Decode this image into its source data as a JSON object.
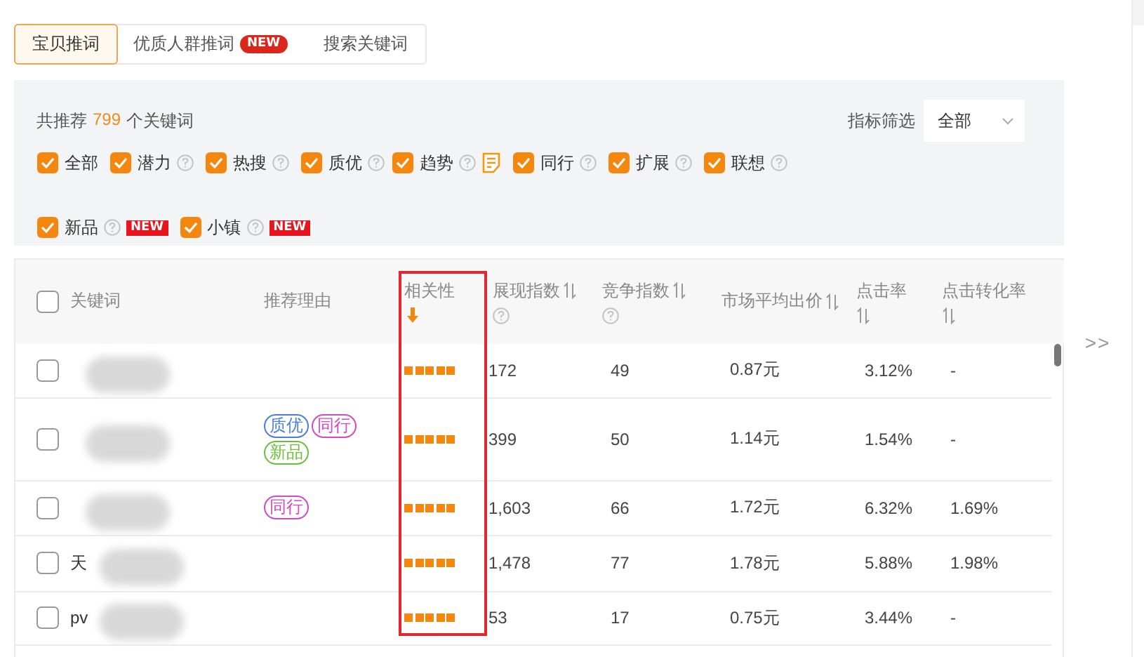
{
  "tabs": [
    {
      "label": "宝贝推词",
      "selected": true
    },
    {
      "label": "优质人群推词",
      "selected": false,
      "badge": "NEW"
    },
    {
      "label": "搜索关键词",
      "selected": false
    }
  ],
  "filters": {
    "summary_prefix": "共推荐",
    "count": "799",
    "summary_suffix": "个关键词",
    "metric_label": "指标筛选",
    "metric_value": "全部",
    "options": [
      {
        "label": "全部",
        "checked": true,
        "help": false
      },
      {
        "label": "潜力",
        "checked": true,
        "help": true
      },
      {
        "label": "热搜",
        "checked": true,
        "help": true
      },
      {
        "label": "质优",
        "checked": true,
        "help": true
      },
      {
        "label": "趋势",
        "checked": true,
        "help": true,
        "note": true
      },
      {
        "label": "同行",
        "checked": true,
        "help": true
      },
      {
        "label": "扩展",
        "checked": true,
        "help": true
      },
      {
        "label": "联想",
        "checked": true,
        "help": true
      },
      {
        "label": "新品",
        "checked": true,
        "help": true,
        "badge": "NEW",
        "line_break_before": true
      },
      {
        "label": "小镇",
        "checked": true,
        "help": true,
        "badge": "NEW"
      }
    ]
  },
  "table": {
    "select_all": false,
    "columns": [
      {
        "label": "关键词",
        "sortable": false,
        "help": false
      },
      {
        "label": "推荐理由",
        "sortable": false,
        "help": false
      },
      {
        "label": "相关性",
        "sortable": false,
        "help": false,
        "sorted_desc": true,
        "highlighted": true
      },
      {
        "label": "展现指数",
        "sortable": true,
        "help": true
      },
      {
        "label": "竞争指数",
        "sortable": true,
        "help": true
      },
      {
        "label": "市场平均出价",
        "sortable": true,
        "help": false
      },
      {
        "label": "点击率",
        "sortable": true,
        "help": false
      },
      {
        "label": "点击转化率",
        "sortable": true,
        "help": false
      }
    ],
    "rows": [
      {
        "cells": [
          {
            "kind": "keyword",
            "checked": false,
            "blurred": true
          },
          {
            "kind": "tags"
          },
          {
            "kind": "rating",
            "stars": 5
          },
          {
            "kind": "text",
            "text": "172"
          },
          {
            "kind": "text",
            "text": "49"
          },
          {
            "kind": "text",
            "text": "0.87元"
          },
          {
            "kind": "text",
            "text": "3.12%"
          },
          {
            "kind": "text",
            "text": "-"
          }
        ]
      },
      {
        "cells": [
          {
            "kind": "keyword",
            "checked": false,
            "blurred": true
          },
          {
            "kind": "tags",
            "tags": [
              {
                "label": "质优",
                "color": "#4a7fe0"
              },
              {
                "label": "同行",
                "color": "#d24bc3"
              },
              {
                "label": "新品",
                "color": "#6cbf3a"
              }
            ]
          },
          {
            "kind": "rating",
            "stars": 5
          },
          {
            "kind": "text",
            "text": "399"
          },
          {
            "kind": "text",
            "text": "50"
          },
          {
            "kind": "text",
            "text": "1.14元"
          },
          {
            "kind": "text",
            "text": "1.54%"
          },
          {
            "kind": "text",
            "text": "-"
          }
        ]
      },
      {
        "cells": [
          {
            "kind": "keyword",
            "checked": false,
            "blurred": true
          },
          {
            "kind": "tags",
            "tags": [
              {
                "label": "同行",
                "color": "#d24bc3"
              }
            ]
          },
          {
            "kind": "rating",
            "stars": 5
          },
          {
            "kind": "text",
            "text": "1,603"
          },
          {
            "kind": "text",
            "text": "66"
          },
          {
            "kind": "text",
            "text": "1.72元"
          },
          {
            "kind": "text",
            "text": "6.32%"
          },
          {
            "kind": "text",
            "text": "1.69%"
          }
        ]
      },
      {
        "cells": [
          {
            "kind": "keyword",
            "checked": false,
            "blurred": true,
            "text": "天"
          },
          {
            "kind": "tags"
          },
          {
            "kind": "rating",
            "stars": 5
          },
          {
            "kind": "text",
            "text": "1,478"
          },
          {
            "kind": "text",
            "text": "77"
          },
          {
            "kind": "text",
            "text": "1.78元"
          },
          {
            "kind": "text",
            "text": "5.88%"
          },
          {
            "kind": "text",
            "text": "1.98%"
          }
        ]
      },
      {
        "cells": [
          {
            "kind": "keyword",
            "checked": false,
            "blurred": true,
            "text": "pv"
          },
          {
            "kind": "tags"
          },
          {
            "kind": "rating",
            "stars": 5
          },
          {
            "kind": "text",
            "text": "53"
          },
          {
            "kind": "text",
            "text": "17"
          },
          {
            "kind": "text",
            "text": "0.75元"
          },
          {
            "kind": "text",
            "text": "3.44%"
          },
          {
            "kind": "text",
            "text": "-"
          }
        ]
      }
    ]
  },
  "expand_label": ">>"
}
